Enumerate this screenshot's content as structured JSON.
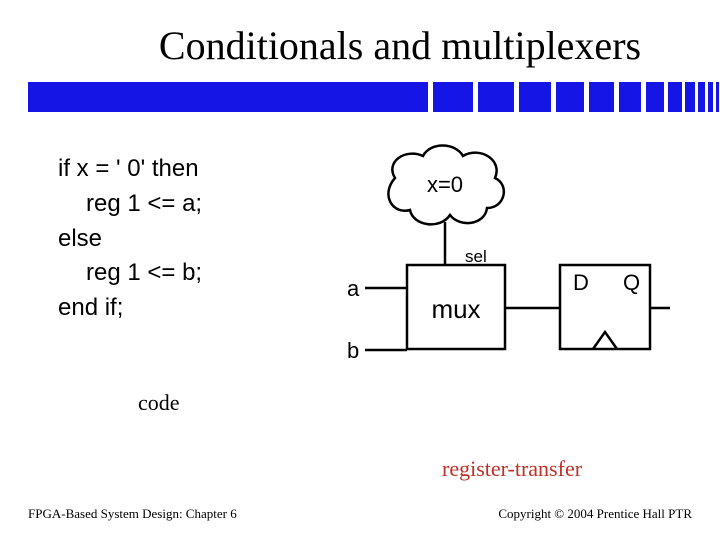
{
  "title": "Conditionals and multiplexers",
  "code": {
    "line1": "if x = ' 0' then",
    "line2": "reg 1 <= a;",
    "line3": "else",
    "line4": "reg 1 <= b;",
    "line5": "end if;"
  },
  "labels": {
    "code": "code",
    "register_transfer": "register-transfer"
  },
  "diagram": {
    "cloud": "x=0",
    "input_a": "a",
    "input_b": "b",
    "mux": "mux",
    "sel": "sel",
    "d": "D",
    "q": "Q"
  },
  "footer": {
    "left": "FPGA-Based System Design: Chapter 6",
    "right": "Copyright © 2004 Prentice Hall PTR"
  }
}
